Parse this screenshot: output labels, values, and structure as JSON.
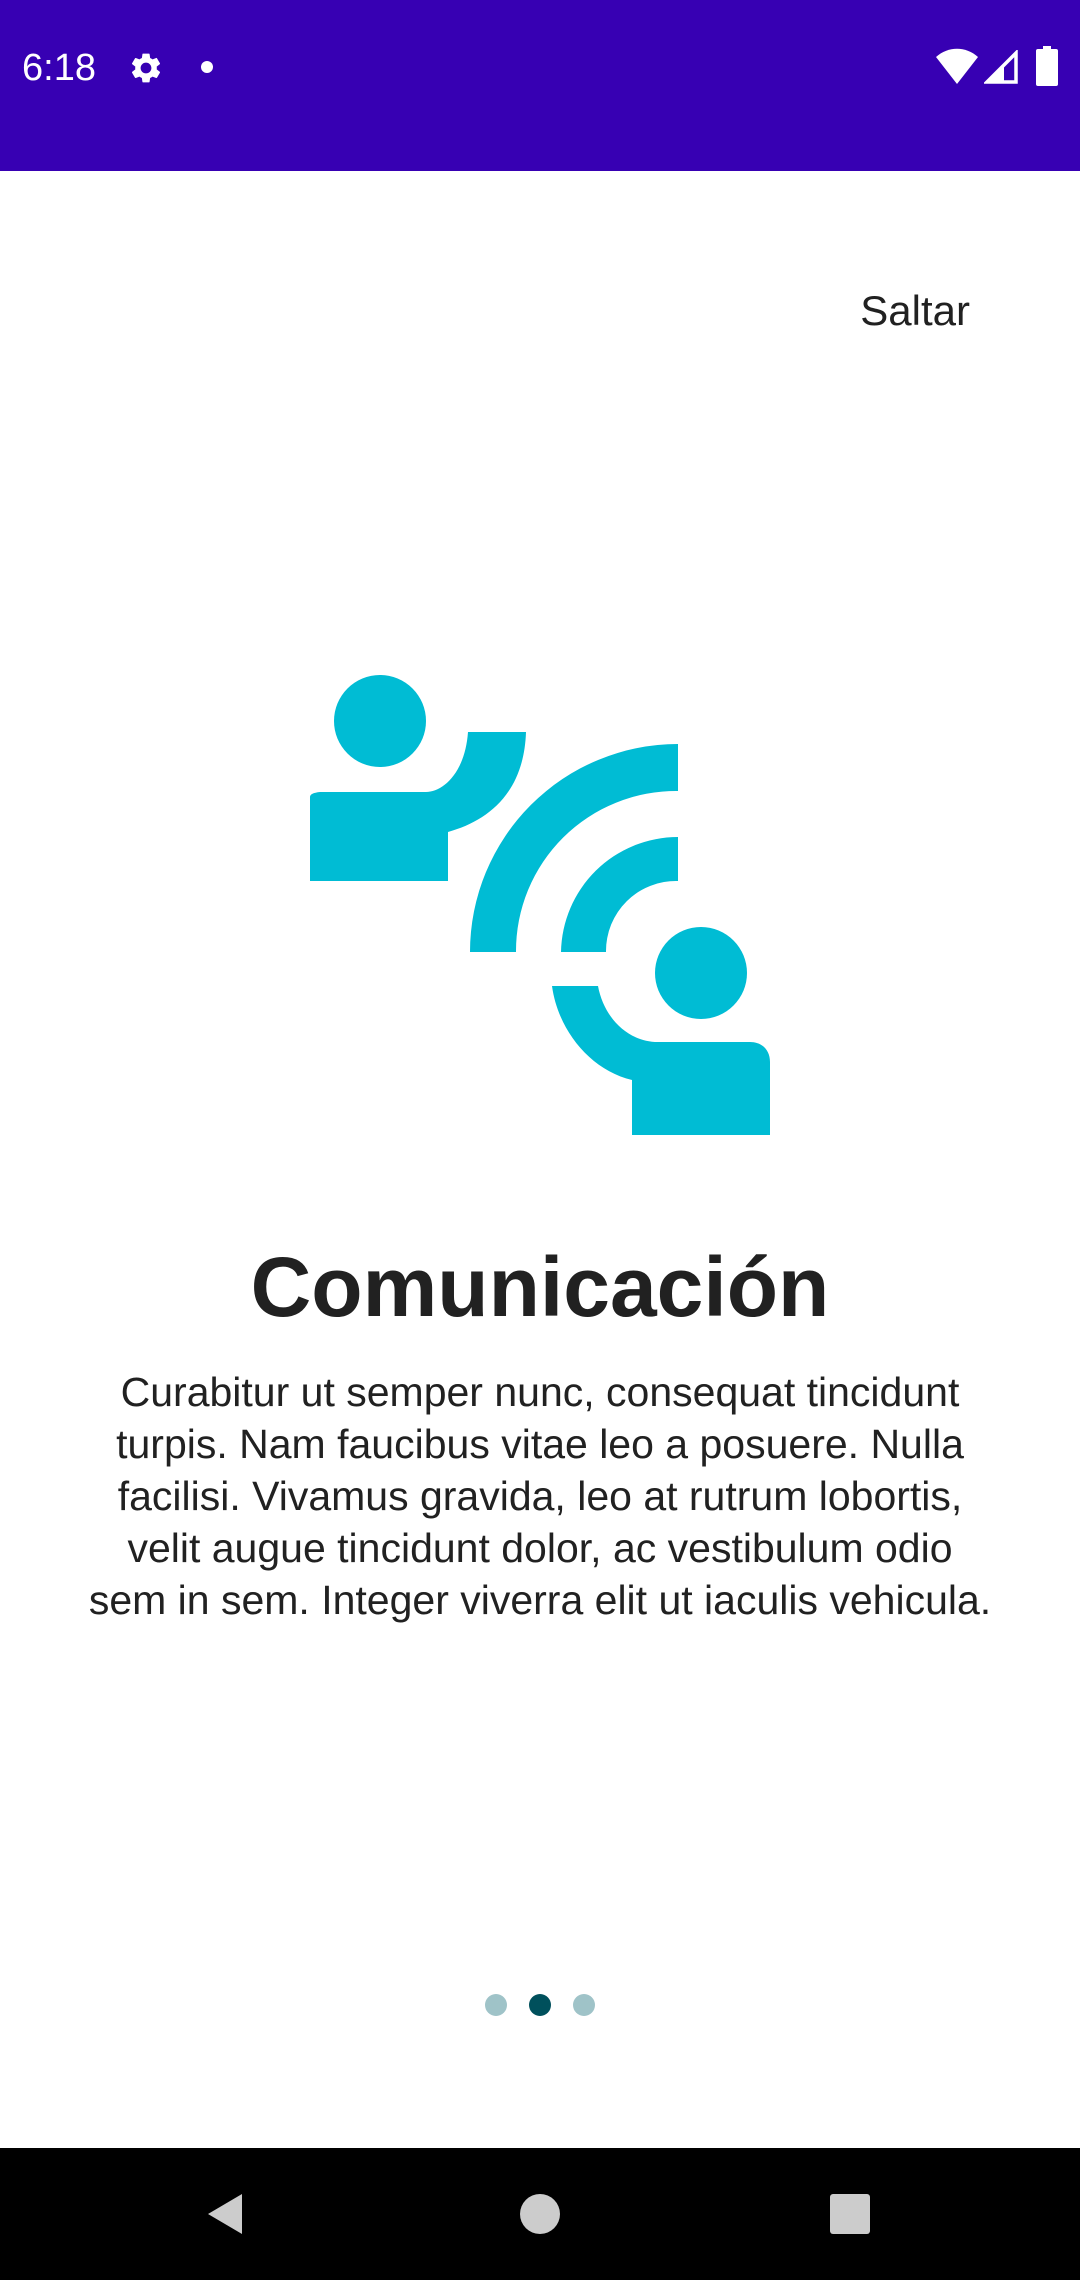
{
  "status_bar": {
    "time": "6:18",
    "background_color": "#3700b3",
    "icons": [
      "gear-icon",
      "notification-dot-icon",
      "wifi-icon",
      "signal-icon",
      "battery-icon"
    ]
  },
  "onboarding": {
    "skip_label": "Saltar",
    "illustration_icon": "communication-people-icon",
    "illustration_color": "#00bcd4",
    "title": "Comunicación",
    "description": "Curabitur ut semper nunc, consequat tincidunt turpis. Nam faucibus vitae leo a posuere. Nulla facilisi. Vivamus gravida, leo at rutrum lobortis, velit augue tincidunt dolor, ac vestibulum odio sem in sem. Integer viverra elit ut iaculis vehicula.",
    "pages_total": 3,
    "current_page": 2,
    "dot_active_color": "#00505c",
    "dot_inactive_color": "#9fc3c8"
  },
  "navigation_bar": {
    "buttons": [
      "back-icon",
      "home-icon",
      "recents-icon"
    ]
  }
}
